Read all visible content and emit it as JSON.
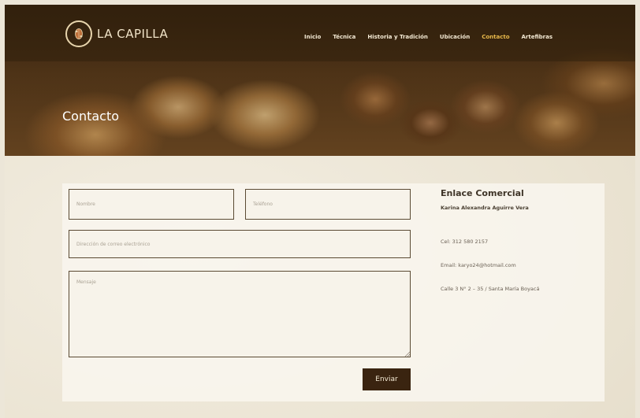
{
  "brand": {
    "name": "LA CAPILLA",
    "logo_icon": "cacao-pod-icon"
  },
  "nav": {
    "items": [
      {
        "label": "Inicio",
        "active": false
      },
      {
        "label": "Técnica",
        "active": false
      },
      {
        "label": "Historia y Tradición",
        "active": false
      },
      {
        "label": "Ubicación",
        "active": false
      },
      {
        "label": "Contacto",
        "active": true
      },
      {
        "label": "Artefibras",
        "active": false
      }
    ]
  },
  "hero": {
    "title": "Contacto"
  },
  "form": {
    "nombre_placeholder": "Nombre",
    "telefono_placeholder": "Teléfono",
    "email_placeholder": "Dirección de correo electrónico",
    "mensaje_placeholder": "Mensaje",
    "submit_label": "Enviar"
  },
  "contact_info": {
    "title": "Enlace Comercial",
    "name": "Karina Alexandra Aguirre Vera",
    "cel": "Cel: 312 580 2157",
    "email": "Email: karyo24@hotmail.com",
    "address": "Calle 3 N° 2 – 35 / Santa María Boyacá"
  },
  "colors": {
    "active_nav": "#e8b84a",
    "button_bg": "#3a2410",
    "field_border": "#5a4a33",
    "page_bg": "#ece6d8"
  }
}
